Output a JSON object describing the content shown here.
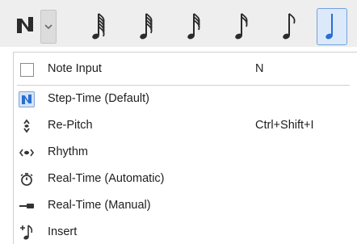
{
  "toolbar": {
    "mode_icon": "step-time-note-icon",
    "dropdown_icon": "chevron-down-icon",
    "durations": [
      {
        "name": "128th-note",
        "flags": 5,
        "active": false
      },
      {
        "name": "64th-note",
        "flags": 4,
        "active": false
      },
      {
        "name": "32nd-note",
        "flags": 3,
        "active": false
      },
      {
        "name": "16th-note",
        "flags": 2,
        "active": false
      },
      {
        "name": "eighth-note",
        "flags": 1,
        "active": false
      },
      {
        "name": "quarter-note",
        "flags": 0,
        "active": true
      }
    ],
    "colors": {
      "accent": "#2a6fd0",
      "note": "#2b2b2b"
    }
  },
  "menu": {
    "note_input": {
      "label": "Note Input",
      "shortcut": "N",
      "checked": false
    },
    "items": [
      {
        "label": "Step-Time (Default)",
        "shortcut": "",
        "icon": "step-time-icon",
        "active": true
      },
      {
        "label": "Re-Pitch",
        "shortcut": "Ctrl+Shift+I",
        "icon": "repitch-icon",
        "active": false
      },
      {
        "label": "Rhythm",
        "shortcut": "",
        "icon": "rhythm-icon",
        "active": false
      },
      {
        "label": "Real-Time (Automatic)",
        "shortcut": "",
        "icon": "stopwatch-icon",
        "active": false
      },
      {
        "label": "Real-Time (Manual)",
        "shortcut": "",
        "icon": "manual-input-icon",
        "active": false
      },
      {
        "label": "Insert",
        "shortcut": "",
        "icon": "insert-note-icon",
        "active": false
      }
    ]
  }
}
